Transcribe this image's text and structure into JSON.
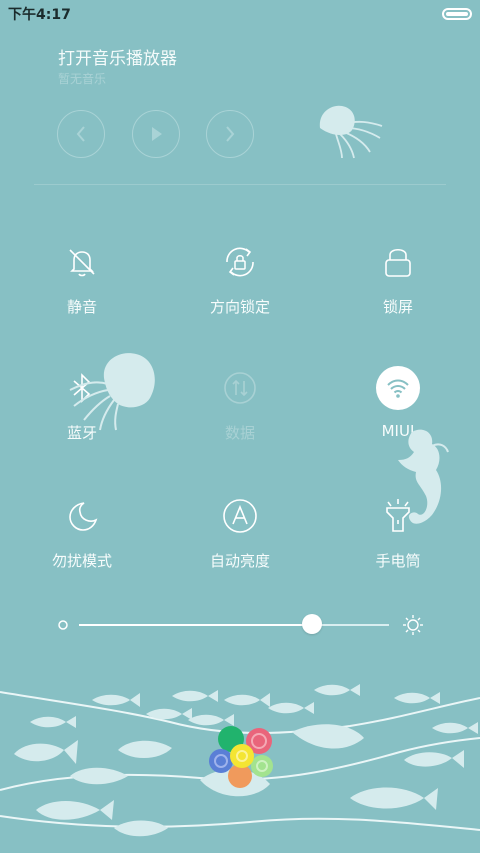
{
  "status_bar": {
    "time": "下午4:17"
  },
  "music": {
    "title": "打开音乐播放器",
    "subtitle": "暂无音乐",
    "controls": [
      {
        "name": "previous-button",
        "icon": "chevron-left-icon"
      },
      {
        "name": "play-button",
        "icon": "play-icon"
      },
      {
        "name": "next-button",
        "icon": "chevron-right-icon"
      }
    ]
  },
  "toggles": [
    {
      "name": "tile-mute",
      "label": "静音",
      "icon": "bell-off-icon",
      "state": "off"
    },
    {
      "name": "tile-rotation-lock",
      "label": "方向锁定",
      "icon": "rotation-lock-icon",
      "state": "off"
    },
    {
      "name": "tile-lock-screen",
      "label": "锁屏",
      "icon": "lock-icon",
      "state": "off"
    },
    {
      "name": "tile-bluetooth",
      "label": "蓝牙",
      "icon": "bluetooth-icon",
      "state": "off"
    },
    {
      "name": "tile-mobile-data",
      "label": "数据",
      "icon": "data-arrows-icon",
      "state": "disabled"
    },
    {
      "name": "tile-wifi",
      "label": "MIUI",
      "icon": "wifi-icon",
      "state": "on"
    },
    {
      "name": "tile-do-not-disturb",
      "label": "勿扰模式",
      "icon": "moon-icon",
      "state": "off"
    },
    {
      "name": "tile-auto-brightness",
      "label": "自动亮度",
      "icon": "auto-brightness-icon",
      "state": "off"
    },
    {
      "name": "tile-flashlight",
      "label": "手电筒",
      "icon": "flashlight-icon",
      "state": "off"
    }
  ],
  "brightness": {
    "level_fraction": 0.75
  },
  "colors": {
    "background": "#87c0c4",
    "foreground": "#ffffff",
    "dim": "#a8d1d4",
    "silhouette": "#d5ebed",
    "flower": [
      "#21b36d",
      "#e9657b",
      "#5a7fd6",
      "#f4e533",
      "#f09a5c",
      "#a3e38f"
    ]
  }
}
